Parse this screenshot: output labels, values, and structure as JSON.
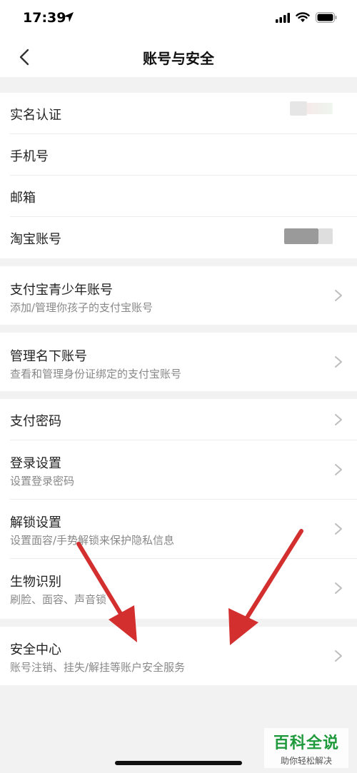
{
  "status": {
    "time": "17:39",
    "icons": [
      "location-arrow-icon",
      "signal-icon",
      "wifi-icon",
      "battery-icon"
    ]
  },
  "nav": {
    "title": "账号与安全",
    "back_icon": "chevron-left-icon"
  },
  "group1": {
    "items": [
      {
        "title": "实名认证"
      },
      {
        "title": "手机号"
      },
      {
        "title": "邮箱"
      },
      {
        "title": "淘宝账号"
      }
    ]
  },
  "group2": {
    "title": "支付宝青少年账号",
    "subtitle": "添加/管理你孩子的支付宝账号"
  },
  "group3": {
    "title": "管理名下账号",
    "subtitle": "查看和管理身份证绑定的支付宝账号"
  },
  "group4": {
    "items": [
      {
        "title": "支付密码",
        "subtitle": ""
      },
      {
        "title": "登录设置",
        "subtitle": "设置登录密码"
      },
      {
        "title": "解锁设置",
        "subtitle": "设置面容/手势解锁来保护隐私信息"
      },
      {
        "title": "生物识别",
        "subtitle": "刷脸、面容、声音锁"
      }
    ]
  },
  "group5": {
    "title": "安全中心",
    "subtitle": "账号注销、挂失/解挂等账户安全服务"
  },
  "watermark": {
    "main": "百科全说",
    "sub": "助你轻松解决"
  },
  "colors": {
    "accent_arrow": "#d32f2f",
    "watermark_green": "#1e9a3c"
  }
}
